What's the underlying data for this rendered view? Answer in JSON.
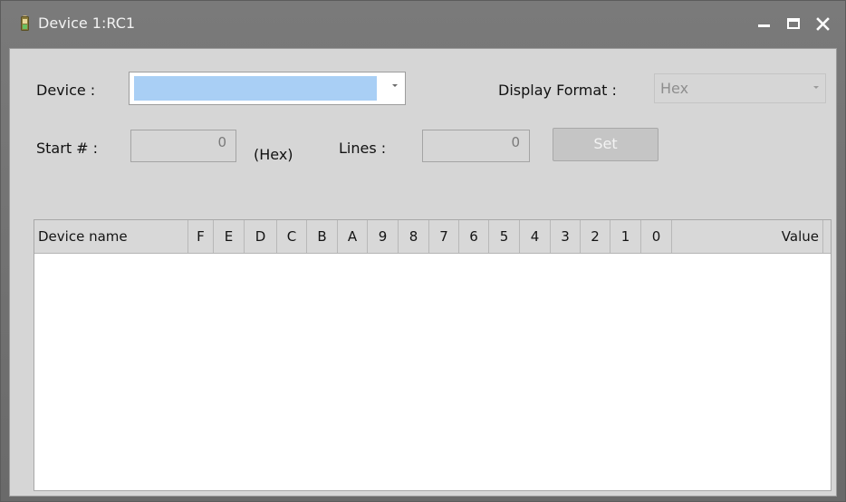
{
  "window": {
    "title": "Device 1:RC1"
  },
  "form": {
    "device_label": "Device :",
    "device_value": "",
    "display_format_label": "Display Format :",
    "display_format_value": "Hex",
    "start_label": "Start # :",
    "start_value": "0",
    "start_unit": "(Hex)",
    "lines_label": "Lines :",
    "lines_value": "0",
    "set_label": "Set"
  },
  "table": {
    "columns": [
      "Device name",
      "F",
      "E",
      "D",
      "C",
      "B",
      "A",
      "9",
      "8",
      "7",
      "6",
      "5",
      "4",
      "3",
      "2",
      "1",
      "0",
      "Value"
    ],
    "rows": []
  },
  "icons": {
    "app": "battery-icon",
    "minimize": "minimize-icon",
    "maximize": "maximize-icon",
    "close": "close-icon",
    "dropdown": "chevron-down-icon"
  },
  "colors": {
    "titlebar": "#6f6f6f",
    "client": "#d6d6d6",
    "selection": "#a9cff5",
    "disabled_text": "#8e8e8e"
  }
}
